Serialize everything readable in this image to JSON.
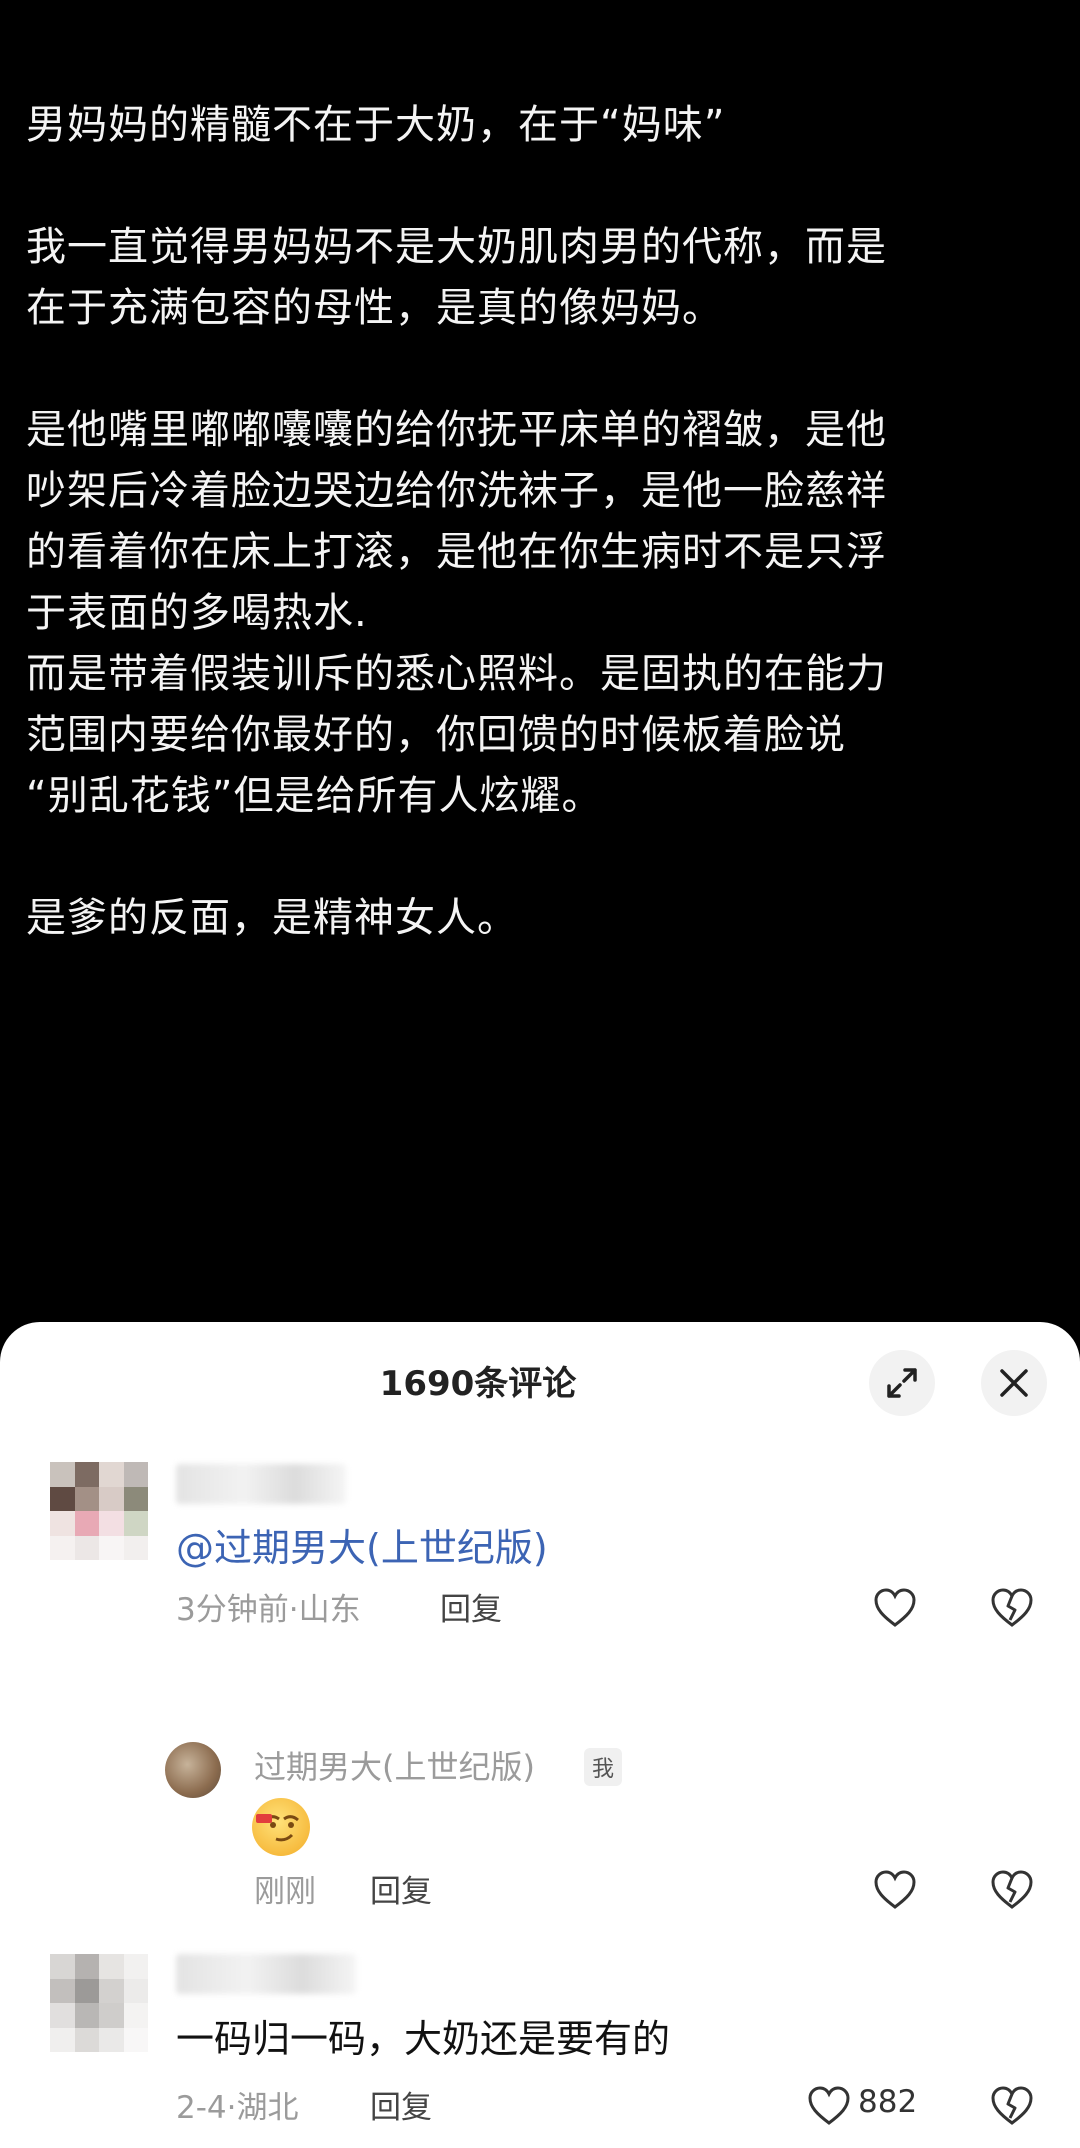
{
  "post": {
    "paragraphs": [
      "男妈妈的精髓不在于大奶，在于“妈味”",
      "",
      "我一直觉得男妈妈不是大奶肌肉男的代称，而是\n在于充满包容的母性，是真的像妈妈。",
      "",
      "是他嘴里嘟嘟囔囔的给你抚平床单的褶皱，是他\n吵架后冷着脸边哭边给你洗袜子，是他一脸慈祥\n的看着你在床上打滚，是他在你生病时不是只浮\n于表面的多喝热水.\n而是带着假装训斥的悉心照料。是固执的在能力\n范围内要给你最好的，你回馈的时候板着脸说\n“别乱花钱”但是给所有人炫耀。",
      "",
      "是爹的反面，是精神女人。"
    ]
  },
  "comments_header": {
    "title": "1690条评论",
    "expand_icon": "expand-icon",
    "close_icon": "close-icon"
  },
  "comments": [
    {
      "text": "@过期男大(上世纪版)",
      "meta": "3分钟前·山东",
      "reply_label": "回复",
      "reply": {
        "author": "过期男大(上世纪版)",
        "badge": "我",
        "emoji_icon": "smirk-emoji-icon",
        "meta": "刚刚",
        "reply_label": "回复"
      }
    },
    {
      "text": "一码归一码，大奶还是要有的",
      "meta": "2-4·湖北",
      "reply_label": "回复",
      "likes": "882"
    }
  ],
  "colors": {
    "background": "#000000",
    "post_text": "#f4f4f4",
    "mention": "#3c64b4",
    "meta": "#9b9b9b"
  }
}
